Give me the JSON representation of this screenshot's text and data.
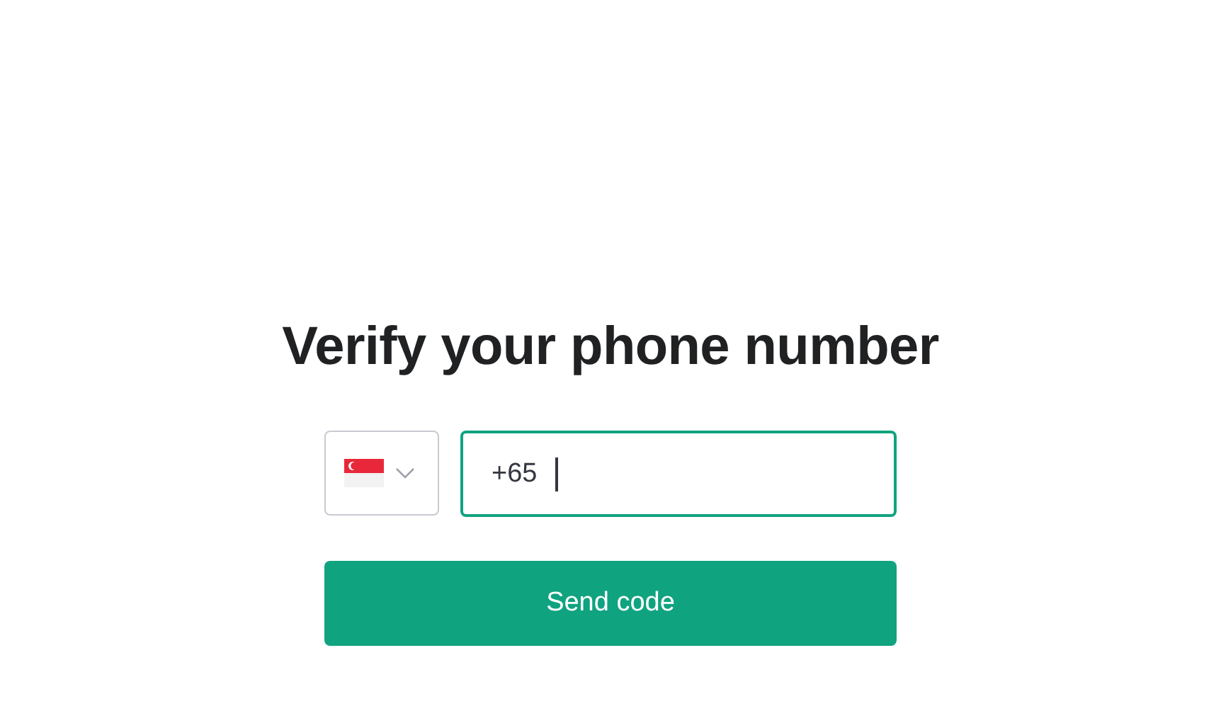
{
  "heading": "Verify your phone number",
  "country_select": {
    "expanded": false
  },
  "phone_field": {
    "value": "+65",
    "focused": true
  },
  "submit_button": {
    "label": "Send code"
  }
}
